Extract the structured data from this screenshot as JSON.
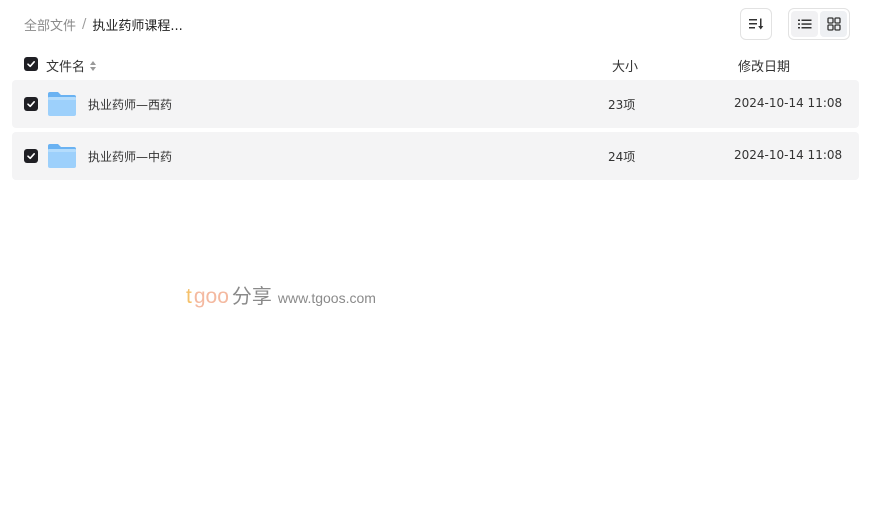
{
  "breadcrumb": {
    "root": "全部文件",
    "separator": "/",
    "current": "执业药师课程..."
  },
  "toolbar": {
    "sort_icon": "sort-icon",
    "list_view_icon": "list-view-icon",
    "grid_view_icon": "grid-view-icon",
    "active_view": "list"
  },
  "table": {
    "columns": {
      "name": "文件名",
      "size": "大小",
      "date": "修改日期"
    },
    "rows": [
      {
        "name": "执业药师—西药",
        "size": "23项",
        "date": "2024-10-14 11:08",
        "checked": true,
        "icon": "folder-icon"
      },
      {
        "name": "执业药师—中药",
        "size": "24项",
        "date": "2024-10-14 11:08",
        "checked": true,
        "icon": "folder-icon"
      }
    ]
  },
  "watermark": {
    "brand_t": "t",
    "brand_goo": "goo",
    "brand_share": "分享",
    "url": "www.tgoos.com"
  },
  "colors": {
    "row_bg": "#f4f4f5",
    "checkbox": "#1f1f24",
    "folder_light": "#9dd0fb",
    "folder_dark": "#6ab2f2"
  }
}
